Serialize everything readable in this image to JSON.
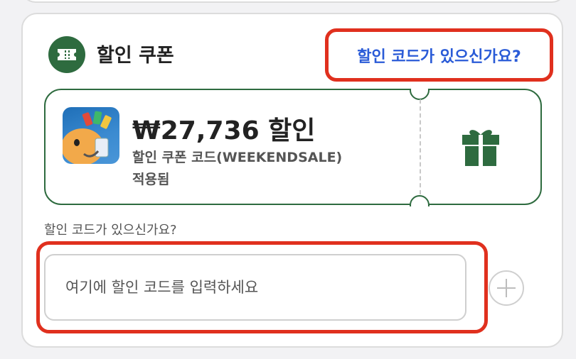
{
  "coupon": {
    "section_title": "할인 쿠폰",
    "code_link": "할인 코드가 있으신가요?",
    "amount": "₩27,736 할인",
    "coupon_line": "할인 쿠폰 코드(WEEKENDSALE)",
    "applied": "적용됨"
  },
  "code_entry": {
    "label": "할인 코드가 있으신가요?",
    "placeholder": "여기에 할인 코드를 입력하세요",
    "value": ""
  },
  "icons": {
    "section": "ticket-icon",
    "gift": "gift-icon",
    "add": "plus-circle-icon"
  },
  "colors": {
    "brand_green": "#2e6b3f",
    "link_blue": "#2a5bd7",
    "highlight_red": "#e0301e"
  }
}
